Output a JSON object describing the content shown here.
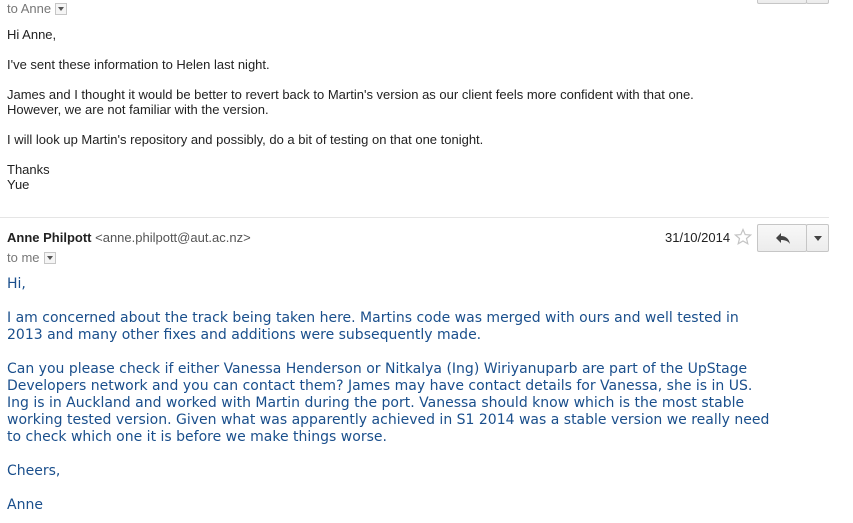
{
  "message1": {
    "recipient_line": "to Anne",
    "greeting": "Hi Anne,",
    "para1": "I've sent these information to Helen last night.",
    "para2_line1": "James and I thought it would be better to revert back to Martin's version as our client feels more confident with that one.",
    "para2_line2": "However, we are not familiar with the version.",
    "para3": "I will look up Martin's repository and possibly, do a bit of testing on that one tonight.",
    "closing": "Thanks",
    "signature": "Yue"
  },
  "message2": {
    "sender_name": "Anne Philpott",
    "sender_email": "<anne.philpott@aut.ac.nz>",
    "date": "31/10/2014",
    "recipient_line": "to me",
    "greeting": "Hi,",
    "para1_line1": "I am concerned about the track being taken here. Martins code was merged with ours and well tested in",
    "para1_line2": "2013 and many other fixes and additions were subsequently made.",
    "para2_line1": "Can you please check if either Vanessa Henderson or Nitkalya (Ing) Wiriyanuparb are part of the UpStage",
    "para2_line2": "Developers network and you can contact them? James may have contact details for Vanessa, she is in US.",
    "para2_line3": "Ing is in Auckland and worked with Martin during the port. Vanessa should know which is the most stable",
    "para2_line4": "working tested version. Given what was apparently achieved in S1 2014 was a stable version we really need",
    "para2_line5": "to check which one it is before we make things worse.",
    "closing": "Cheers,",
    "signature": "Anne"
  },
  "icons": {
    "star": "star-icon",
    "reply": "reply-icon",
    "more": "chevron-down-icon"
  }
}
